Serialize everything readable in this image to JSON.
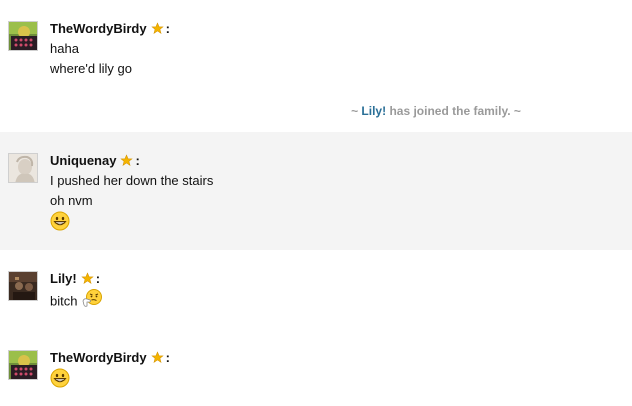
{
  "messages": [
    {
      "user": "TheWordyBirdy",
      "lines": [
        "haha",
        "where'd lily go"
      ]
    },
    {
      "user": "Uniquenay",
      "lines": [
        "I pushed her down the stairs",
        "oh nvm"
      ],
      "emoji": "grin-emoji"
    },
    {
      "user": "Lily!",
      "lines": [
        "bitch"
      ],
      "emoji": "thinking-emoji"
    },
    {
      "user": "TheWordyBirdy",
      "emoji": "grin-emoji"
    }
  ],
  "system_notice": {
    "prefix": "~",
    "user": "Lily!",
    "text": "has joined the family.",
    "suffix": "~"
  },
  "separator": ":",
  "icons": {
    "badge": "star-icon",
    "avatar_style": "thumbnail"
  },
  "colors": {
    "alt_row_bg": "#f4f4f4",
    "system_text": "#9a9a9a",
    "system_user": "#2a6f97",
    "star": "#f4b400"
  }
}
